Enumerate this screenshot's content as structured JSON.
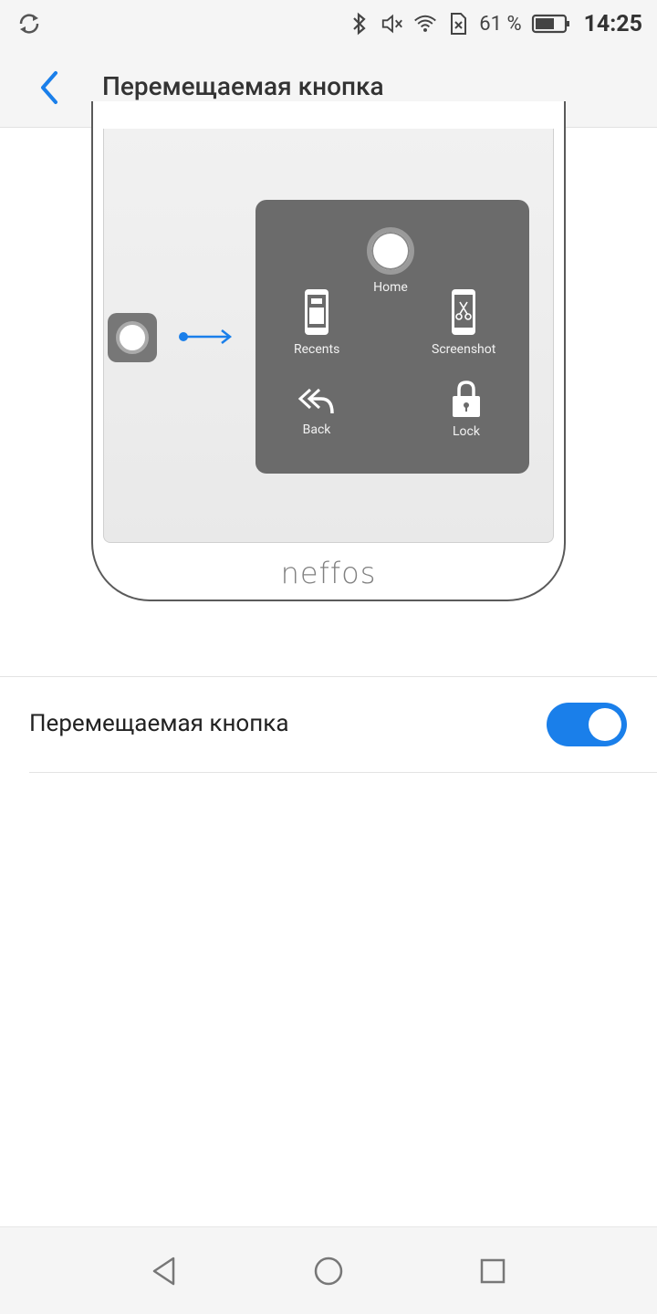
{
  "status_bar": {
    "battery_percent": "61 %",
    "time": "14:25",
    "icons": [
      "sync-icon",
      "bluetooth-icon",
      "mute-icon",
      "wifi-icon",
      "sim-off-icon",
      "battery-icon"
    ]
  },
  "app_bar": {
    "title": "Перемещаемая кнопка",
    "back_icon": "chevron-left-icon"
  },
  "illustration": {
    "brand": "neffos",
    "menu": {
      "home": "Home",
      "recents": "Recents",
      "screenshot": "Screenshot",
      "back": "Back",
      "lock": "Lock"
    }
  },
  "settings": {
    "floating_button": {
      "label": "Перемещаемая кнопка",
      "enabled": true
    }
  },
  "nav_bar": {
    "icons": [
      "nav-back-icon",
      "nav-home-icon",
      "nav-recents-icon"
    ]
  },
  "colors": {
    "accent": "#1a7fea",
    "menu_panel": "#6b6b6b",
    "background": "#ffffff",
    "bar_background": "#f5f5f5"
  }
}
